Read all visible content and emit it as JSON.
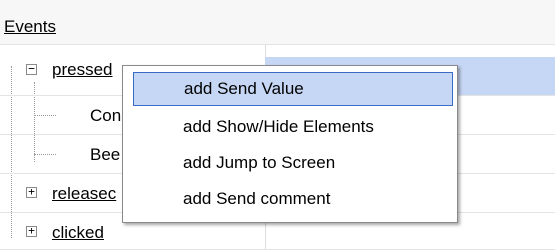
{
  "events_header": "Events",
  "tree": {
    "pressed": "pressed",
    "sub_item_1": "Con",
    "sub_item_2": "Bee",
    "released": "releasec",
    "clicked": "clicked",
    "expand_symbol": "−",
    "collapse_symbol": "+"
  },
  "context_menu": {
    "items": [
      {
        "label": "add Send Value",
        "highlighted": true
      },
      {
        "label": "add Show/Hide Elements",
        "highlighted": false
      },
      {
        "label": "add Jump to Screen",
        "highlighted": false
      },
      {
        "label": "add Send comment",
        "highlighted": false
      }
    ]
  },
  "colors": {
    "selection": "#c6d7f5",
    "menu_highlight_border": "#3b6bc8"
  }
}
